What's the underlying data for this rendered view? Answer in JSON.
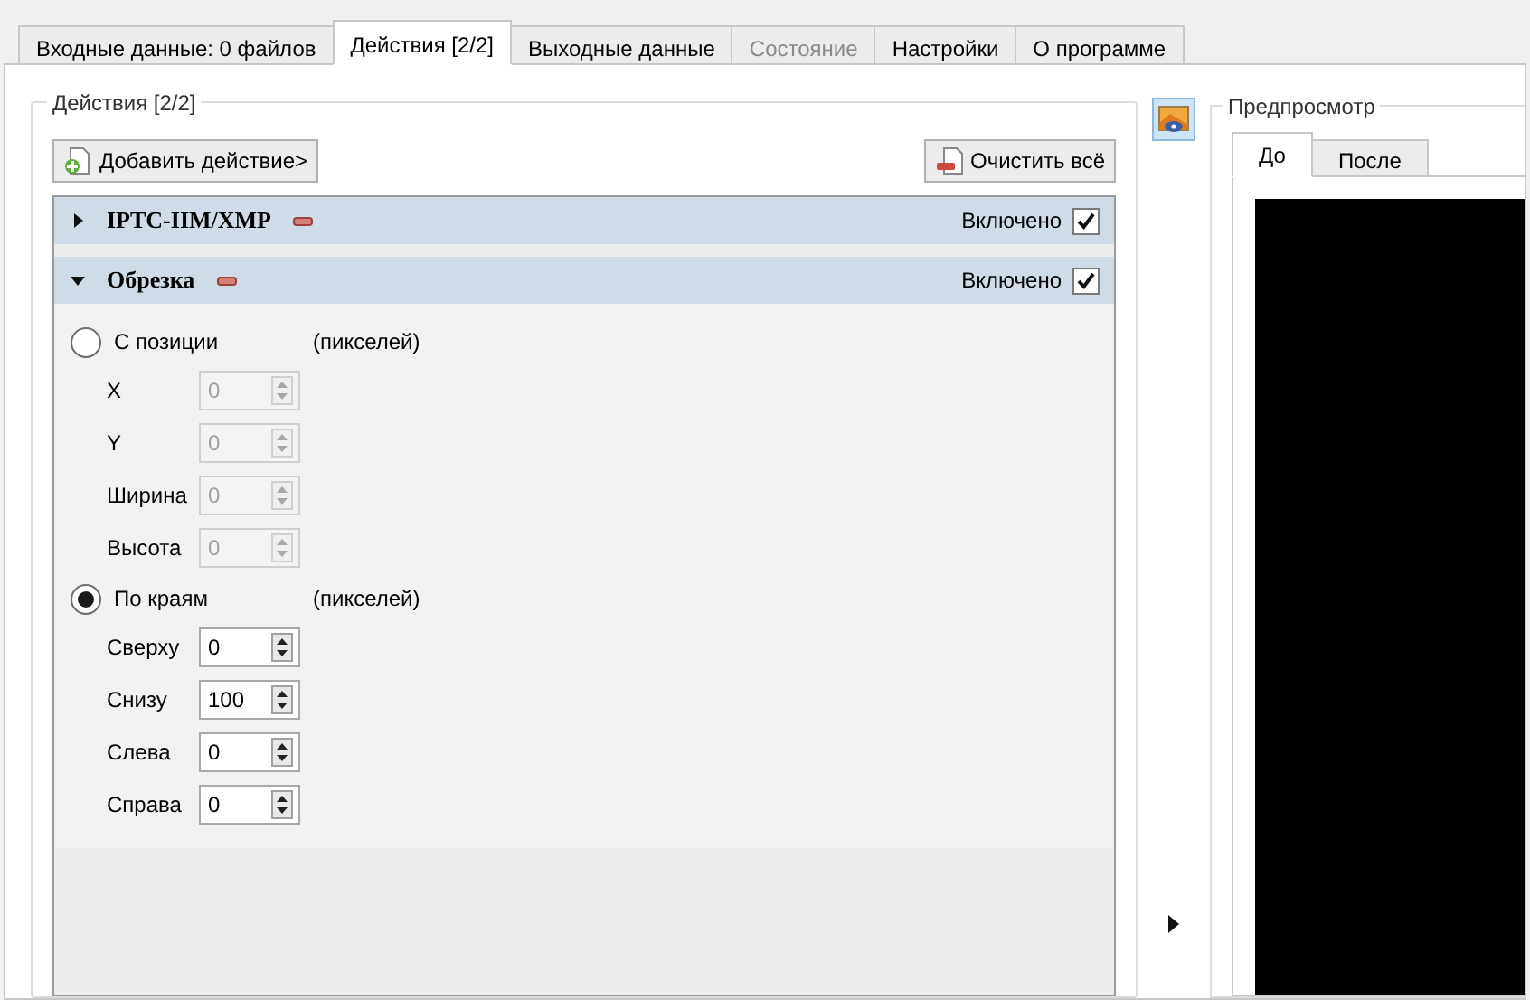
{
  "tabs": [
    {
      "label": "Входные данные: 0 файлов",
      "selected": false,
      "disabled": false
    },
    {
      "label": "Действия [2/2]",
      "selected": true,
      "disabled": false
    },
    {
      "label": "Выходные данные",
      "selected": false,
      "disabled": false
    },
    {
      "label": "Состояние",
      "selected": false,
      "disabled": true
    },
    {
      "label": "Настройки",
      "selected": false,
      "disabled": false
    },
    {
      "label": "О программе",
      "selected": false,
      "disabled": false
    }
  ],
  "actions_group": {
    "title": "Действия [2/2]",
    "add_button": "Добавить действие>",
    "clear_button": "Очистить всё",
    "actions": [
      {
        "title": "IPTC-IIM/XMP",
        "expanded": false,
        "enabled_label": "Включено",
        "enabled": true
      },
      {
        "title": "Обрезка",
        "expanded": true,
        "enabled_label": "Включено",
        "enabled": true,
        "options": [
          {
            "label": "С позиции",
            "unit": "(пикселей)",
            "selected": false,
            "fields": [
              {
                "label": "X",
                "value": "0",
                "disabled": true
              },
              {
                "label": "Y",
                "value": "0",
                "disabled": true
              },
              {
                "label": "Ширина",
                "value": "0",
                "disabled": true
              },
              {
                "label": "Высота",
                "value": "0",
                "disabled": true
              }
            ]
          },
          {
            "label": "По краям",
            "unit": "(пикселей)",
            "selected": true,
            "fields": [
              {
                "label": "Сверху",
                "value": "0",
                "disabled": false
              },
              {
                "label": "Снизу",
                "value": "100",
                "disabled": false
              },
              {
                "label": "Слева",
                "value": "0",
                "disabled": false
              },
              {
                "label": "Справа",
                "value": "0",
                "disabled": false
              }
            ]
          }
        ]
      }
    ]
  },
  "preview": {
    "title": "Предпросмотр",
    "tabs": [
      {
        "label": "До",
        "selected": true
      },
      {
        "label": "После",
        "selected": false
      }
    ]
  }
}
